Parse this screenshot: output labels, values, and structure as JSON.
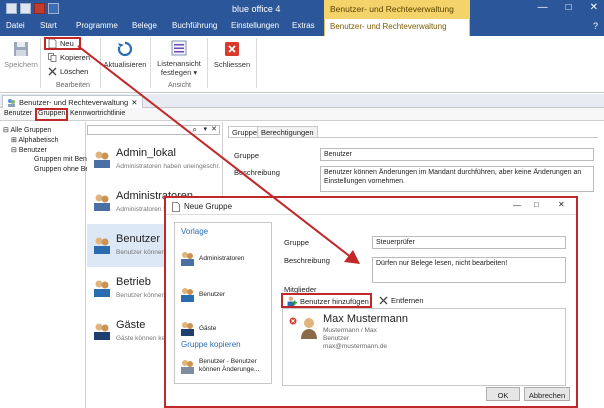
{
  "window": {
    "title": "blue office 4",
    "context_title": "Benutzer- und Rechteverwaltung",
    "buttons": {
      "minimize": "—",
      "maximize": "□",
      "close": "✕"
    },
    "help": "?"
  },
  "tabs": {
    "datei": "Datei",
    "start": "Start",
    "programme": "Programme",
    "belege": "Belege",
    "buchfuehrung": "Buchführung",
    "einstellungen": "Einstellungen",
    "extras": "Extras",
    "context": "Benutzer- und Rechteverwaltung"
  },
  "ribbon": {
    "speichern": "Speichern",
    "neu": "Neu",
    "kopieren": "Kopieren",
    "loeschen": "Löschen",
    "group_bearbeiten": "Bearbeiten",
    "aktualisieren": "Aktualisieren",
    "listenansicht_1": "Listenansicht",
    "listenansicht_2": "festlegen ▾",
    "group_ansicht": "Ansicht",
    "schliessen": "Schliessen"
  },
  "doc_tab": {
    "label": "Benutzer- und Rechteverwaltung",
    "close": "✕"
  },
  "subtabs": {
    "benutzer": "Benutzer",
    "gruppen": "Gruppen",
    "kennwort": "Kennwortrichtlinie"
  },
  "tree": {
    "alle": "Alle Gruppen",
    "alphabetisch": "Alphabetisch",
    "benutzer": "Benutzer",
    "mit": "Gruppen mit Benu...",
    "ohne": "Gruppen ohne Ben..."
  },
  "grouplist": {
    "items": [
      {
        "name": "Admin_lokal",
        "desc": "Administratoren haben uneingeschr..."
      },
      {
        "name": "Administratoren",
        "desc": "Administratoren haben uneingeschr..."
      },
      {
        "name": "Benutzer",
        "desc": "Benutzer können Änderungen..."
      },
      {
        "name": "Betrieb",
        "desc": "Benutzer können Änderungen..."
      },
      {
        "name": "Gäste",
        "desc": "Gäste können keine Änderungen..."
      }
    ]
  },
  "detail": {
    "tab_gruppe": "Gruppe",
    "tab_berechtigungen": "Berechtigungen",
    "label_gruppe": "Gruppe",
    "value_gruppe": "Benutzer",
    "label_beschreibung": "Beschreibung",
    "value_beschreibung": "Benutzer können Änderungen im Mandant durchführen, aber keine Änderungen an Einstellungen vornehmen."
  },
  "dialog": {
    "title": "Neue Gruppe",
    "vorlage": "Vorlage",
    "templates": [
      "Administratoren",
      "Benutzer",
      "Gäste"
    ],
    "gruppe_kopieren": "Gruppe kopieren",
    "copy_line1": "Benutzer - Benutzer",
    "copy_line2": "können Änderunge...",
    "label_gruppe": "Gruppe",
    "value_gruppe": "Steuerprüfer",
    "label_beschreibung": "Beschreibung",
    "value_beschreibung": "Dürfen nur Belege lesen, nicht bearbeiten!",
    "label_mitglieder": "Mitglieder",
    "add_user": "Benutzer hinzufügen",
    "remove": "Entfernen",
    "member": {
      "name": "Max Mustermann",
      "line1": "Mustermann / Max",
      "line2": "Benutzer",
      "email": "max@mustermann.de"
    },
    "ok": "OK",
    "cancel": "Abbrechen"
  },
  "colors": {
    "accent": "#2b579a",
    "context": "#f4d36b",
    "highlight": "#c0282a"
  }
}
